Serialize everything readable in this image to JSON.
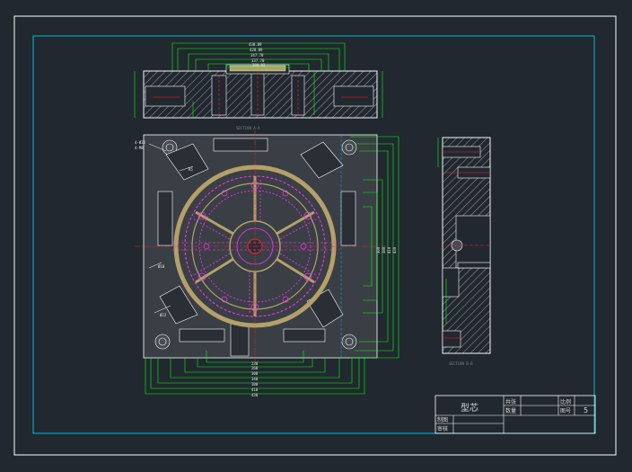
{
  "drawing": {
    "section_top_label": "SECTION A-A",
    "section_right_label": "SECTION B-B",
    "top_dims": [
      "438.89",
      "428.89",
      "347.70",
      "337.70",
      "280.92",
      "180.8"
    ],
    "bottom_dims": [
      "430",
      "410",
      "380",
      "340",
      "300",
      "260",
      "230",
      "190",
      "150"
    ],
    "right_dims": [
      "430",
      "410",
      "380",
      "300",
      "240",
      "190"
    ],
    "left_labels": [
      "4-Ø22",
      "4-M8",
      "Ø10",
      "Ø22",
      "R5",
      "10",
      "15"
    ]
  },
  "title_block": {
    "part_name": "型芯",
    "label_qty": "共张",
    "label_qty2": "数量",
    "label_scale": "比例",
    "label_drawing_no": "图号",
    "drawing_no_value": "5",
    "label_drafted": "制图",
    "label_checked": "审核"
  },
  "colors": {
    "background": "#212830",
    "frame": "#00bcd4",
    "dimension": "#00ff00",
    "outline": "#ffffff",
    "hidden": "#ff2020",
    "hatch": "#c8c8c8",
    "part_fill": "#b5a06a",
    "magenta": "#ff30ff"
  }
}
